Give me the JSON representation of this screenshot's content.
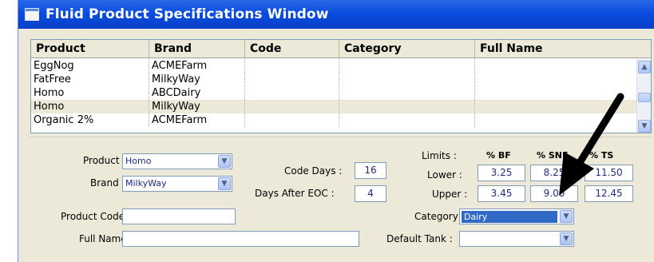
{
  "window": {
    "title": "Fluid Product Specifications Window"
  },
  "table": {
    "columns": [
      "Product",
      "Brand",
      "Code",
      "Category",
      "Full Name"
    ],
    "rows": [
      {
        "product": "EggNog",
        "brand": "ACMEFarm",
        "selected": false
      },
      {
        "product": "FatFree",
        "brand": "MilkyWay",
        "selected": false
      },
      {
        "product": "Homo",
        "brand": "ABCDairy",
        "selected": false
      },
      {
        "product": "Homo",
        "brand": "MilkyWay",
        "selected": true
      },
      {
        "product": "Organic 2%",
        "brand": "ACMEFarm",
        "selected": false
      }
    ],
    "scroll_up_icon": "chevron-up-icon",
    "scroll_down_icon": "chevron-down-icon"
  },
  "form": {
    "product_label": "Product :",
    "product_value": "Homo",
    "brand_label": "Brand :",
    "brand_value": "MilkyWay",
    "code_days_label": "Code Days :",
    "code_days_value": "16",
    "days_after_eoc_label": "Days After EOC :",
    "days_after_eoc_value": "4",
    "product_code_label": "Product Code :",
    "product_code_value": "",
    "full_name_label": "Full Name :",
    "full_name_value": "",
    "limits_label": "Limits :",
    "lower_label": "Lower :",
    "upper_label": "Upper :",
    "col_bf": "% BF",
    "col_snf": "% SNF",
    "col_ts": "% TS",
    "lower_bf": "3.25",
    "lower_snf": "8.25",
    "lower_ts": "11.50",
    "upper_bf": "3.45",
    "upper_snf": "9.00",
    "upper_ts": "12.45",
    "category_label": "Category :",
    "category_value": "Dairy",
    "default_tank_label": "Default Tank :",
    "default_tank_value": ""
  },
  "annotation": {
    "arrow_color": "#000000"
  }
}
